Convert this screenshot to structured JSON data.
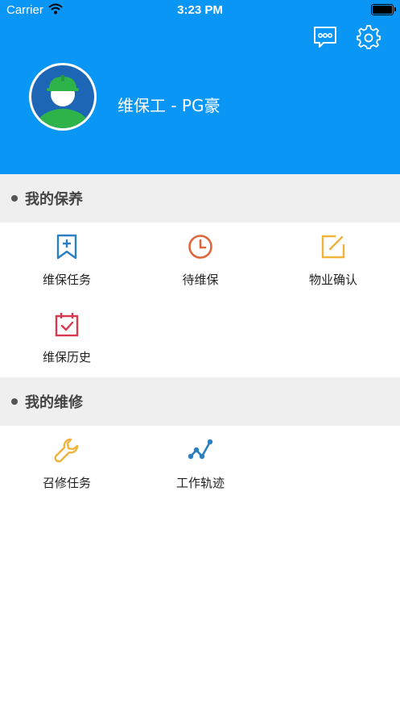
{
  "status_bar": {
    "carrier": "Carrier",
    "time": "3:23 PM"
  },
  "header": {
    "user_name": "维保工 - PG豪",
    "bg_color": "#0a96f5"
  },
  "sections": [
    {
      "title": "我的保养",
      "items": [
        {
          "label": "维保任务",
          "icon": "bookmark-plus-icon",
          "color": "#2b7fc3"
        },
        {
          "label": "待维保",
          "icon": "clock-icon",
          "color": "#e0663b"
        },
        {
          "label": "物业确认",
          "icon": "edit-square-icon",
          "color": "#f0b43b"
        },
        {
          "label": "维保历史",
          "icon": "calendar-check-icon",
          "color": "#d8384f"
        }
      ]
    },
    {
      "title": "我的维修",
      "items": [
        {
          "label": "召修任务",
          "icon": "wrench-icon",
          "color": "#f0b43b"
        },
        {
          "label": "工作轨迹",
          "icon": "track-line-icon",
          "color": "#2b7fc3"
        }
      ]
    }
  ]
}
